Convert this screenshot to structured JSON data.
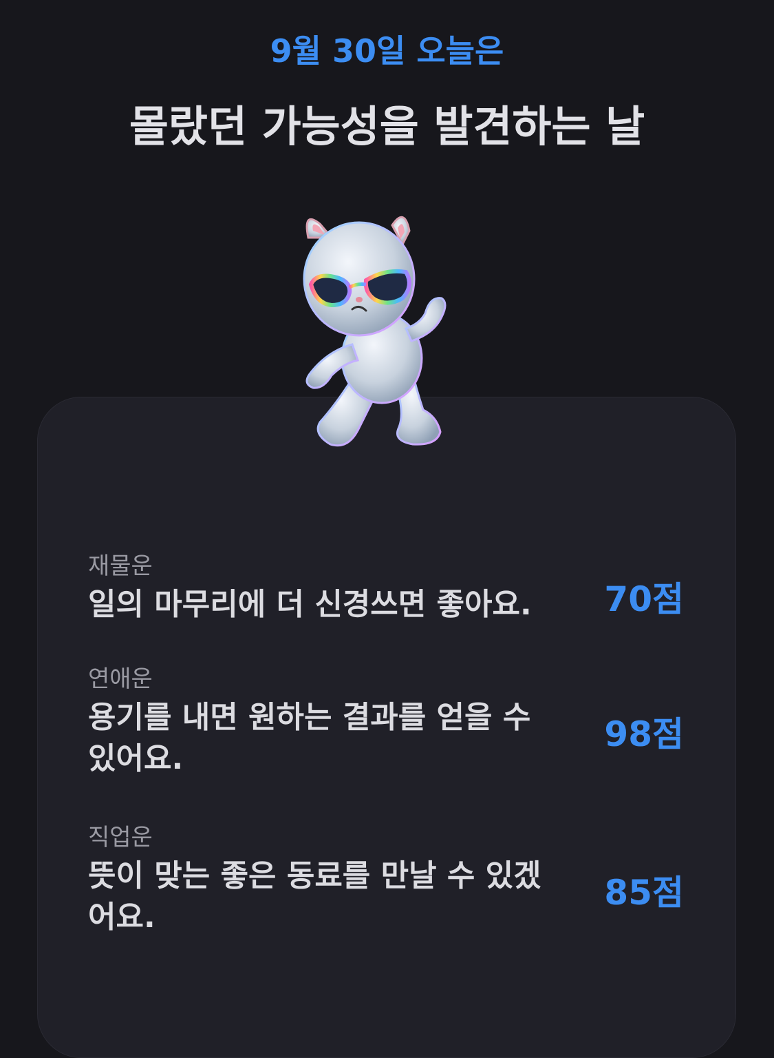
{
  "header": {
    "date_line": "9월 30일 오늘은",
    "headline": "몰랐던 가능성을 발견하는 날"
  },
  "mascot": {
    "icon": "cat-mascot-icon"
  },
  "colors": {
    "accent": "#3c8df2",
    "background": "#17171c",
    "card": "#202028"
  },
  "fortunes": [
    {
      "label": "재물운",
      "text": "일의 마무리에 더 신경쓰면 좋아요.",
      "score": "70점"
    },
    {
      "label": "연애운",
      "text": "용기를 내면 원하는 결과를 얻을 수 있어요.",
      "score": "98점"
    },
    {
      "label": "직업운",
      "text": "뜻이 맞는 좋은 동료를 만날 수 있겠어요.",
      "score": "85점"
    }
  ]
}
